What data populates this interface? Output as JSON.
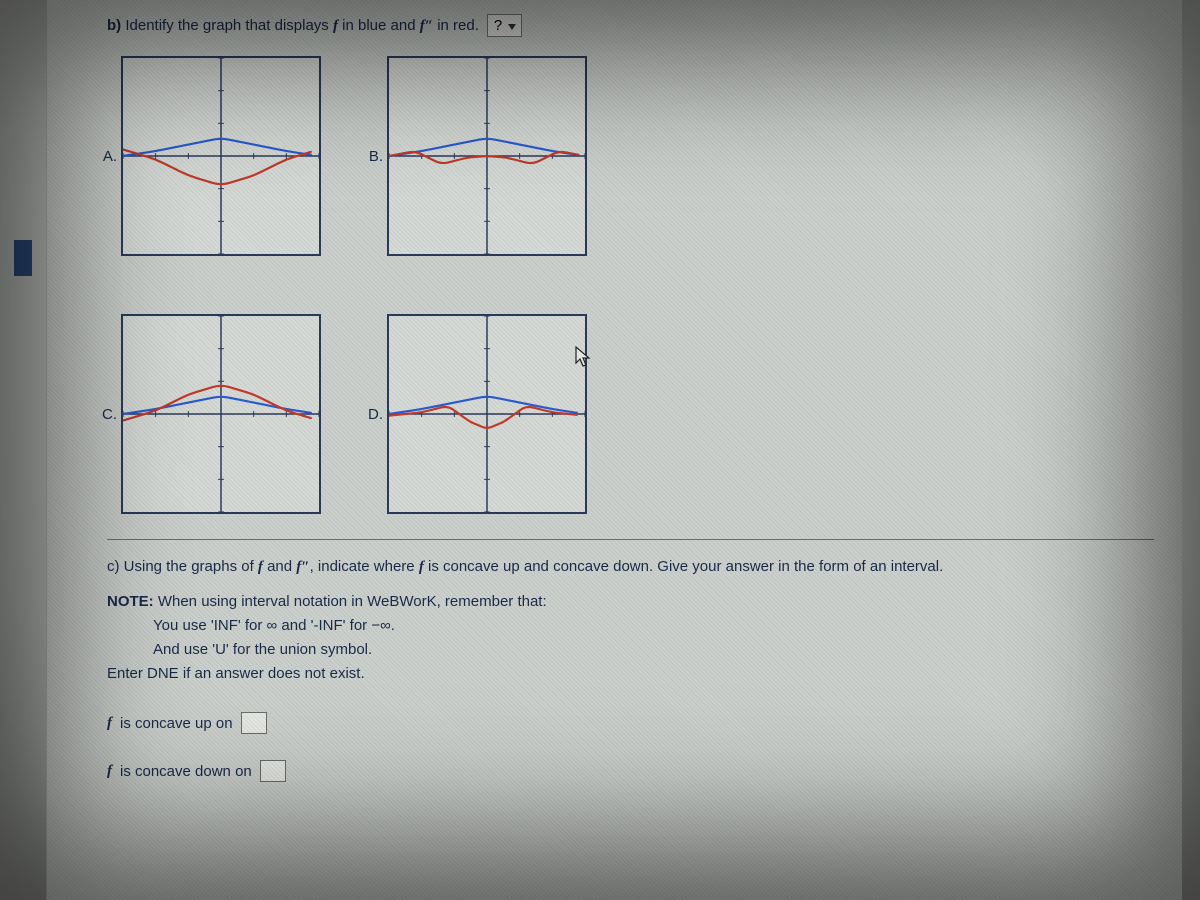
{
  "partB": {
    "label": "b)",
    "text_before": "Identify the graph that displays",
    "f_blue": "f",
    "mid": "in blue and",
    "fpp_red": "f″",
    "text_after": "in red.",
    "select_placeholder": "?",
    "options": {
      "A": "A.",
      "B": "B.",
      "C": "C.",
      "D": "D."
    }
  },
  "partC": {
    "text_lead": "c) Using the graphs of",
    "f": "f",
    "and": "and",
    "fpp": "f″",
    "text_mid": ", indicate where",
    "f2": "f",
    "text_tail": "is concave up and concave down. Give your answer in the form of an interval."
  },
  "note": {
    "head": "NOTE:",
    "l1a": "When using interval notation in WeBWorK, remember that:",
    "l2": "You use 'INF' for ∞ and '-INF' for −∞.",
    "l3": "And use 'U' for the union symbol.",
    "l4": "Enter DNE if an answer does not exist."
  },
  "answers": {
    "up_label_f": "f",
    "up_label": "is concave up on",
    "down_label_f": "f",
    "down_label": "is concave down on"
  },
  "chart_data": [
    {
      "id": "A",
      "type": "line",
      "xlabel": "",
      "ylabel": "",
      "xlim": [
        -3,
        3
      ],
      "ylim": [
        -3,
        3
      ],
      "series": [
        {
          "name": "f (blue)",
          "color": "#2a5bd0",
          "x": [
            -3,
            -2,
            -1,
            0,
            1,
            2,
            3
          ],
          "values": [
            0.0,
            0.15,
            0.35,
            0.55,
            0.35,
            0.15,
            0.0
          ]
        },
        {
          "name": "f'' (red)",
          "color": "#c43a2a",
          "x": [
            -3,
            -2,
            -1,
            0,
            1,
            2,
            3
          ],
          "values": [
            0.2,
            -0.1,
            -0.6,
            -0.9,
            -0.6,
            -0.1,
            0.2
          ]
        }
      ]
    },
    {
      "id": "B",
      "type": "line",
      "xlabel": "",
      "ylabel": "",
      "xlim": [
        -3,
        3
      ],
      "ylim": [
        -3,
        3
      ],
      "series": [
        {
          "name": "f (blue)",
          "color": "#2a5bd0",
          "x": [
            -3,
            -2,
            -1,
            0,
            1,
            2,
            3
          ],
          "values": [
            0.0,
            0.15,
            0.35,
            0.55,
            0.35,
            0.15,
            0.0
          ]
        },
        {
          "name": "f'' (red)",
          "color": "#c43a2a",
          "x": [
            -3,
            -2.2,
            -1.4,
            -0.6,
            0,
            0.6,
            1.4,
            2.2,
            3
          ],
          "values": [
            0.0,
            0.15,
            -0.25,
            -0.05,
            0.0,
            -0.05,
            -0.25,
            0.15,
            0.0
          ]
        }
      ]
    },
    {
      "id": "C",
      "type": "line",
      "xlabel": "",
      "ylabel": "",
      "xlim": [
        -3,
        3
      ],
      "ylim": [
        -3,
        3
      ],
      "series": [
        {
          "name": "f (blue)",
          "color": "#2a5bd0",
          "x": [
            -3,
            -2,
            -1,
            0,
            1,
            2,
            3
          ],
          "values": [
            0.0,
            0.15,
            0.35,
            0.55,
            0.35,
            0.15,
            0.0
          ]
        },
        {
          "name": "f'' (red)",
          "color": "#c43a2a",
          "x": [
            -3,
            -2,
            -1,
            0,
            1,
            2,
            3
          ],
          "values": [
            -0.2,
            0.1,
            0.6,
            0.9,
            0.6,
            0.1,
            -0.2
          ]
        }
      ]
    },
    {
      "id": "D",
      "type": "line",
      "xlabel": "",
      "ylabel": "",
      "xlim": [
        -3,
        3
      ],
      "ylim": [
        -3,
        3
      ],
      "series": [
        {
          "name": "f (blue)",
          "color": "#2a5bd0",
          "x": [
            -3,
            -2,
            -1,
            0,
            1,
            2,
            3
          ],
          "values": [
            0.0,
            0.15,
            0.35,
            0.55,
            0.35,
            0.15,
            0.0
          ]
        },
        {
          "name": "f'' (red)",
          "color": "#c43a2a",
          "x": [
            -3,
            -2,
            -1.2,
            -0.5,
            0,
            0.5,
            1.2,
            2,
            3
          ],
          "values": [
            -0.05,
            0.05,
            0.25,
            -0.25,
            -0.45,
            -0.25,
            0.25,
            0.05,
            -0.05
          ]
        }
      ]
    }
  ]
}
